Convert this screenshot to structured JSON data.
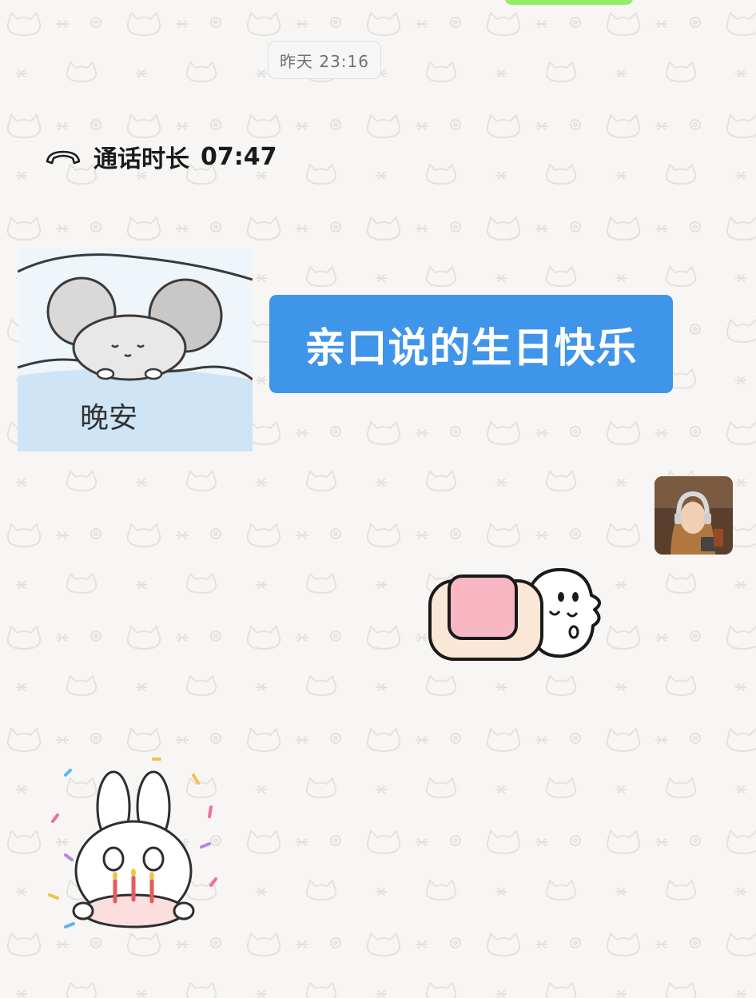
{
  "chat": {
    "timestamp": "昨天 23:16",
    "call": {
      "label": "通话时长",
      "duration": "07:47",
      "icon": "phone-hangup-icon"
    },
    "stickers": [
      {
        "name": "goodnight-mouse-sticker",
        "text": "晚安"
      },
      {
        "name": "sleeping-blanket-sticker"
      },
      {
        "name": "birthday-bunny-sticker"
      }
    ],
    "message": {
      "text": "亲口说的生日快乐",
      "bubble_color": "#3f95ea"
    },
    "colors": {
      "outgoing_bubble": "#95ec69",
      "wallpaper": "#f7f6f5"
    }
  }
}
